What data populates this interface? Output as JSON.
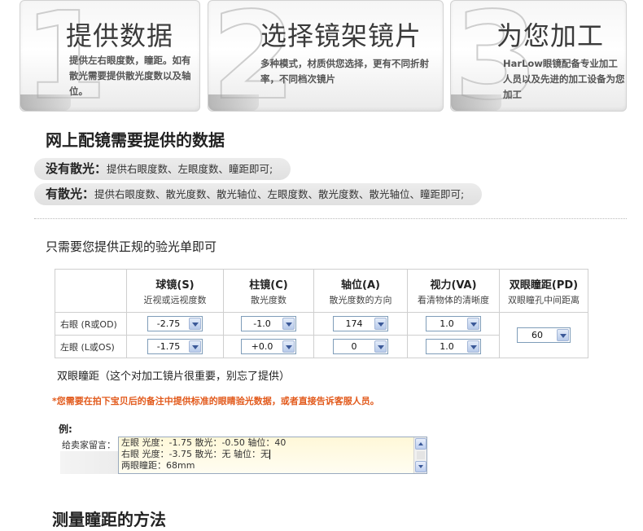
{
  "steps": [
    {
      "num": "1",
      "title": "提供数据",
      "desc": "提供左右眼度数，瞳距。如有散光需要提供散光度数以及轴位。"
    },
    {
      "num": "2",
      "title": "选择镜架镜片",
      "desc": "多种模式，材质供您选择，更有不同折射率，不同档次镜片"
    },
    {
      "num": "3",
      "title": "为您加工",
      "desc": "HarLow眼镜配备专业加工人员以及先进的加工设备为您加工"
    }
  ],
  "section1": {
    "title": "网上配镜需要提供的数据",
    "no_astig_label": "没有散光：",
    "no_astig_text": "提供右眼度数、左眼度数、瞳距即可;",
    "astig_label": "有散光：",
    "astig_text": "提供右眼度数、散光度数、散光轴位、左眼度数、散光度数、散光轴位、瞳距即可;"
  },
  "need_text": "只需要您提供正规的验光单即可",
  "table": {
    "headers": [
      {
        "main": "球镜(S)",
        "sub": "近视或远视度数"
      },
      {
        "main": "柱镜(C)",
        "sub": "散光度数"
      },
      {
        "main": "轴位(A)",
        "sub": "散光度数的方向"
      },
      {
        "main": "视力(VA)",
        "sub": "看清物体的清晰度"
      },
      {
        "main": "双眼瞳距(PD)",
        "sub": "双眼瞳孔中间距离"
      }
    ],
    "rows": [
      {
        "label": "右眼 (R或OD)",
        "values": [
          "-2.75",
          "-1.0",
          "174",
          "1.0"
        ]
      },
      {
        "label": "左眼 (L或OS)",
        "values": [
          "-1.75",
          "+0.0",
          "0",
          "1.0"
        ]
      }
    ],
    "pd_value": "60"
  },
  "pd_note": "双眼瞳距（这个对加工镜片很重要，别忘了提供）",
  "warning": "*您需要在拍下宝贝后的备注中提供标准的眼睛验光数据，或者直接告诉客服人员。",
  "example": {
    "label": "例:",
    "field_label": "给卖家留言：",
    "lines": [
      "左眼 光度：-1.75 散光：-0.50 轴位：40",
      "右眼 光度：-3.75 散光：无 轴位：无",
      "两眼瞳距：68mm"
    ]
  },
  "section2_title": "测量瞳距的方法",
  "colors": {
    "warning": "#e25a1c",
    "select_border": "#7f9db9",
    "textarea_bg": "#fff8d8"
  }
}
